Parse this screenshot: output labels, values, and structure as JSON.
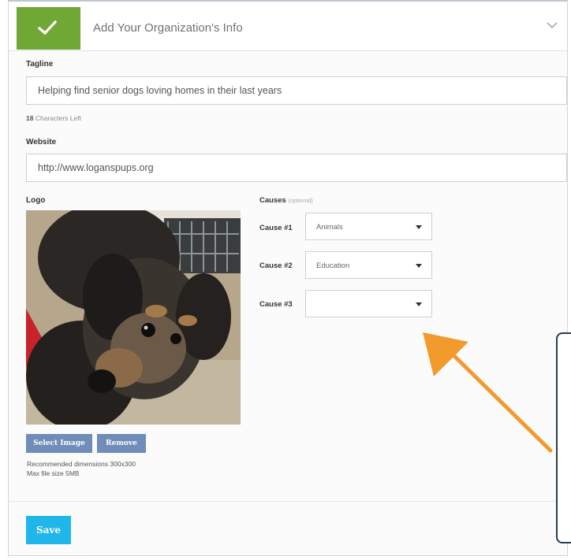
{
  "header": {
    "title": "Add Your Organization's Info"
  },
  "tagline": {
    "label": "Tagline",
    "value": "Helping find senior dogs loving homes in their last years",
    "chars_left_count": "18",
    "chars_left_text": "Characters Left"
  },
  "website": {
    "label": "Website",
    "value": "http://www.loganspups.org"
  },
  "logo": {
    "label": "Logo",
    "select_button": "Select Image",
    "remove_button": "Remove",
    "recommended": "Recommended dimensions 300x300",
    "max_size": "Max file size 5MB"
  },
  "causes": {
    "label": "Causes",
    "optional": "(optional)",
    "items": [
      {
        "label": "Cause #1",
        "value": "Animals"
      },
      {
        "label": "Cause #2",
        "value": "Education"
      },
      {
        "label": "Cause #3",
        "value": ""
      }
    ]
  },
  "save_button": "Save",
  "colors": {
    "check_green": "#6fa834",
    "save_blue": "#1fb6ea",
    "image_button_blue": "#6f8db8",
    "arrow_orange": "#f39a2d"
  },
  "icons": [
    "check-icon",
    "chevron-down-icon",
    "caret-down-icon",
    "arrow-annotation"
  ]
}
